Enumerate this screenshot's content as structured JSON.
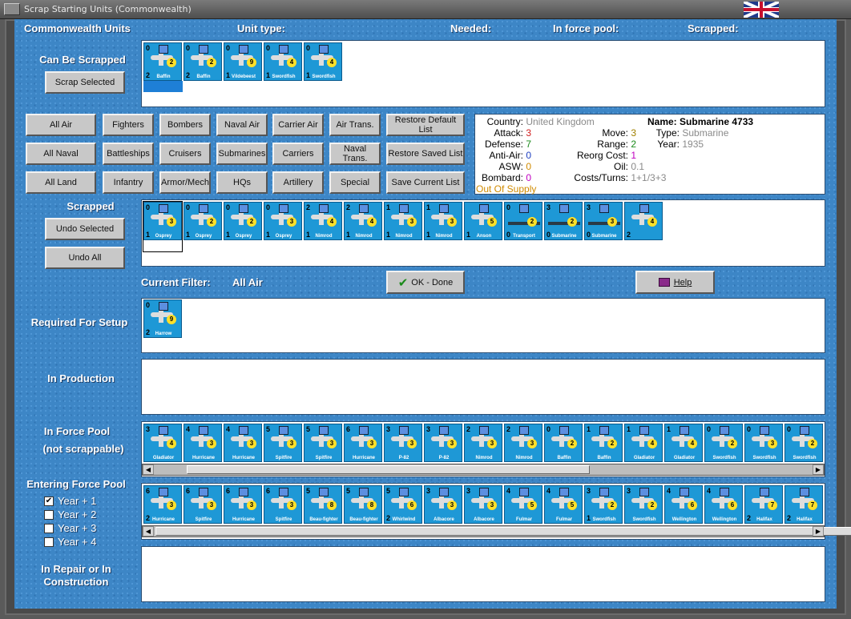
{
  "window": {
    "title": "Scrap Starting Units (Commonwealth)"
  },
  "header": {
    "units": "Commonwealth Units",
    "unit_type": "Unit type:",
    "needed": "Needed:",
    "force_pool": "In force pool:",
    "scrapped": "Scrapped:"
  },
  "sections": {
    "can_be_scrapped": "Can Be Scrapped",
    "scrapped": "Scrapped",
    "required": "Required For Setup",
    "in_production": "In Production",
    "in_force_pool_1": "In Force Pool",
    "in_force_pool_2": "(not scrappable)",
    "entering": "Entering Force Pool",
    "repair_1": "In Repair or In",
    "repair_2": "Construction"
  },
  "buttons": {
    "scrap_selected": "Scrap Selected",
    "undo_selected": "Undo Selected",
    "undo_all": "Undo All",
    "ok": "OK - Done",
    "help": "Help",
    "filters": [
      "All Air",
      "Fighters",
      "Bombers",
      "Naval Air",
      "Carrier Air",
      "Air Trans.",
      "Restore Default List",
      "All Naval",
      "Battleships",
      "Cruisers",
      "Submarines",
      "Carriers",
      "Naval Trans.",
      "Restore Saved List",
      "All Land",
      "Infantry",
      "Armor/Mech",
      "HQs",
      "Artillery",
      "Special",
      "Save Current List"
    ]
  },
  "filter": {
    "label": "Current Filter:",
    "value": "All Air"
  },
  "info": {
    "country_k": "Country:",
    "country_v": "United Kingdom",
    "attack_k": "Attack:",
    "attack_v": "3",
    "defense_k": "Defense:",
    "defense_v": "7",
    "aa_k": "Anti-Air:",
    "aa_v": "0",
    "asw_k": "ASW:",
    "asw_v": "0",
    "bombard_k": "Bombard:",
    "bombard_v": "0",
    "supply": "Out Of Supply",
    "move_k": "Move:",
    "move_v": "3",
    "range_k": "Range:",
    "range_v": "2",
    "reorg_k": "Reorg Cost:",
    "reorg_v": "1",
    "oil_k": "Oil:",
    "oil_v": "0.1",
    "costs_k": "Costs/Turns:",
    "costs_v": "1+1/3+3",
    "name_k": "Name:",
    "name_v": "Submarine 4733",
    "type_k": "Type:",
    "type_v": "Submarine",
    "year_k": "Year:",
    "year_v": "1935"
  },
  "years": [
    "Year + 1",
    "Year + 2",
    "Year + 3",
    "Year + 4"
  ],
  "years_checked": [
    true,
    false,
    false,
    false
  ],
  "counters": {
    "can_scrap": [
      {
        "n": "Baffin",
        "tl": "0",
        "l": "2",
        "c": "2"
      },
      {
        "n": "Baffin",
        "tl": "0",
        "l": "2",
        "c": "2"
      },
      {
        "n": "Vildebeest",
        "tl": "0",
        "l": "1",
        "c": "9"
      },
      {
        "n": "Swordfish",
        "tl": "0",
        "l": "1",
        "c": "4"
      },
      {
        "n": "Swordfish",
        "tl": "0",
        "l": "1",
        "c": "4"
      }
    ],
    "scrapped": [
      {
        "n": "Osprey",
        "tl": "0",
        "l": "1",
        "c": "3"
      },
      {
        "n": "Osprey",
        "tl": "0",
        "l": "1",
        "c": "2"
      },
      {
        "n": "Osprey",
        "tl": "0",
        "l": "1",
        "c": "2"
      },
      {
        "n": "Osprey",
        "tl": "0",
        "l": "1",
        "c": "3"
      },
      {
        "n": "Nimrod",
        "tl": "2",
        "l": "1",
        "c": "4"
      },
      {
        "n": "Nimrod",
        "tl": "2",
        "l": "1",
        "c": "4"
      },
      {
        "n": "Nimrod",
        "tl": "1",
        "l": "1",
        "c": "3"
      },
      {
        "n": "Nimrod",
        "tl": "1",
        "l": "1",
        "c": "3"
      },
      {
        "n": "Anson",
        "tl": "",
        "l": "1",
        "c": "5"
      },
      {
        "n": "Transport",
        "tl": "0",
        "l": "0",
        "c": "2"
      },
      {
        "n": "Submarine",
        "tl": "3",
        "l": "0",
        "c": "2"
      },
      {
        "n": "Submarine",
        "tl": "3",
        "l": "0",
        "c": "3"
      },
      {
        "n": "",
        "tl": "",
        "l": "2",
        "c": "4"
      }
    ],
    "required": [
      {
        "n": "Harrow",
        "tl": "0",
        "l": "2",
        "c": "9"
      }
    ],
    "force_pool": [
      {
        "n": "Gladiator",
        "tl": "3",
        "l": "",
        "c": "4"
      },
      {
        "n": "Hurricane",
        "tl": "4",
        "l": "",
        "c": "3"
      },
      {
        "n": "Hurricane",
        "tl": "4",
        "l": "",
        "c": "3"
      },
      {
        "n": "Spitfire",
        "tl": "5",
        "l": "",
        "c": "3"
      },
      {
        "n": "Spitfire",
        "tl": "5",
        "l": "",
        "c": "3"
      },
      {
        "n": "Hurricane",
        "tl": "6",
        "l": "",
        "c": "3"
      },
      {
        "n": "P-82",
        "tl": "3",
        "l": "",
        "c": "3"
      },
      {
        "n": "P-82",
        "tl": "3",
        "l": "",
        "c": "3"
      },
      {
        "n": "Nimrod",
        "tl": "2",
        "l": "",
        "c": "3"
      },
      {
        "n": "Nimrod",
        "tl": "2",
        "l": "",
        "c": "3"
      },
      {
        "n": "Baffin",
        "tl": "0",
        "l": "",
        "c": "2"
      },
      {
        "n": "Baffin",
        "tl": "1",
        "l": "",
        "c": "2"
      },
      {
        "n": "Gladiator",
        "tl": "1",
        "l": "",
        "c": "4"
      },
      {
        "n": "Gladiator",
        "tl": "1",
        "l": "",
        "c": "4"
      },
      {
        "n": "Swordfish",
        "tl": "0",
        "l": "",
        "c": "2"
      },
      {
        "n": "Swordfish",
        "tl": "0",
        "l": "",
        "c": "3"
      },
      {
        "n": "Swordfish",
        "tl": "0",
        "l": "",
        "c": "2"
      }
    ],
    "entering": [
      {
        "n": "Hurricane",
        "tl": "6",
        "l": "2",
        "c": "3"
      },
      {
        "n": "Spitfire",
        "tl": "6",
        "l": "",
        "c": "3"
      },
      {
        "n": "Hurricane",
        "tl": "6",
        "l": "",
        "c": "3"
      },
      {
        "n": "Spitfire",
        "tl": "6",
        "l": "",
        "c": "3"
      },
      {
        "n": "Beau-fighter",
        "tl": "5",
        "l": "",
        "c": "8"
      },
      {
        "n": "Beau-fighter",
        "tl": "5",
        "l": "",
        "c": "8"
      },
      {
        "n": "Whirlwind",
        "tl": "5",
        "l": "2",
        "c": "6"
      },
      {
        "n": "Albacore",
        "tl": "3",
        "l": "",
        "c": "3"
      },
      {
        "n": "Albacore",
        "tl": "3",
        "l": "",
        "c": "3"
      },
      {
        "n": "Fulmar",
        "tl": "4",
        "l": "",
        "c": "5"
      },
      {
        "n": "Fulmar",
        "tl": "4",
        "l": "",
        "c": "5"
      },
      {
        "n": "Swordfish",
        "tl": "3",
        "l": "1",
        "c": "2"
      },
      {
        "n": "Swordfish",
        "tl": "3",
        "l": "",
        "c": "2"
      },
      {
        "n": "Wellington",
        "tl": "4",
        "l": "",
        "c": "6"
      },
      {
        "n": "Wellington",
        "tl": "4",
        "l": "",
        "c": "6"
      },
      {
        "n": "Halifax",
        "tl": "",
        "l": "2",
        "c": "7"
      },
      {
        "n": "Halifax",
        "tl": "",
        "l": "2",
        "c": "7"
      }
    ]
  }
}
